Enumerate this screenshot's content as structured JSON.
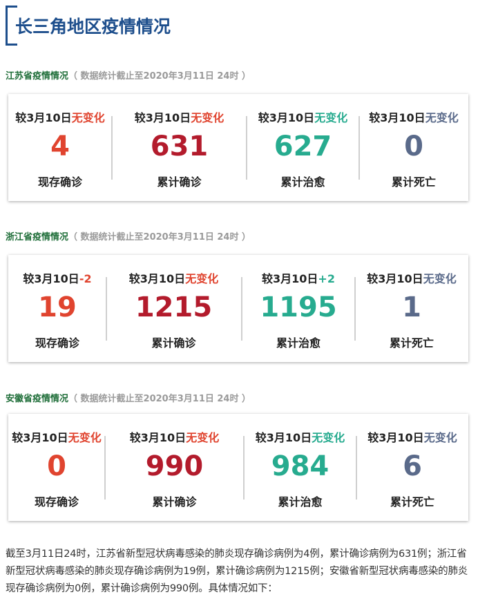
{
  "title": "长三角地区疫情情况",
  "sections": [
    {
      "province": "江苏省疫情情况",
      "note": "（ 数据统计截止至2020年3月11日 24时 ）",
      "stats": [
        {
          "compare_prefix": "较3月10日",
          "compare_value": "无变化",
          "value": "4",
          "label": "现存确诊"
        },
        {
          "compare_prefix": "较3月10日",
          "compare_value": "无变化",
          "value": "631",
          "label": "累计确诊"
        },
        {
          "compare_prefix": "较3月10日",
          "compare_value": "无变化",
          "value": "627",
          "label": "累计治愈"
        },
        {
          "compare_prefix": "较3月10日",
          "compare_value": "无变化",
          "value": "0",
          "label": "累计死亡"
        }
      ]
    },
    {
      "province": "浙江省疫情情况",
      "note": "（ 数据统计截止至2020年3月11日 24时 ）",
      "stats": [
        {
          "compare_prefix": "较3月10日",
          "compare_value": "-2",
          "value": "19",
          "label": "现存确诊"
        },
        {
          "compare_prefix": "较3月10日",
          "compare_value": "无变化",
          "value": "1215",
          "label": "累计确诊"
        },
        {
          "compare_prefix": "较3月10日",
          "compare_value": "+2",
          "value": "1195",
          "label": "累计治愈"
        },
        {
          "compare_prefix": "较3月10日",
          "compare_value": "无变化",
          "value": "1",
          "label": "累计死亡"
        }
      ]
    },
    {
      "province": "安徽省疫情情况",
      "note": "（ 数据统计截止至2020年3月11日 24时 ）",
      "stats": [
        {
          "compare_prefix": "较3月10日",
          "compare_value": "无变化",
          "value": "0",
          "label": "现存确诊"
        },
        {
          "compare_prefix": "较3月10日",
          "compare_value": "无变化",
          "value": "990",
          "label": "累计确诊"
        },
        {
          "compare_prefix": "较3月10日",
          "compare_value": "无变化",
          "value": "984",
          "label": "累计治愈"
        },
        {
          "compare_prefix": "较3月10日",
          "compare_value": "无变化",
          "value": "6",
          "label": "累计死亡"
        }
      ]
    }
  ],
  "footer": "截至3月11日24时，江苏省新型冠状病毒感染的肺炎现存确诊病例为4例，累计确诊病例为631例；浙江省新型冠状病毒感染的肺炎现存确诊病例为19例，累计确诊病例为1215例；安徽省新型冠状病毒感染的肺炎现存确诊病例为0例，累计确诊病例为990例。具体情况如下：",
  "colors": {
    "title": "#1d4e8c",
    "province": "#1f6e39",
    "current_confirmed": "#e0442f",
    "total_confirmed": "#b31b2c",
    "total_cured": "#27ab8f",
    "total_deaths": "#5a6a8a"
  }
}
